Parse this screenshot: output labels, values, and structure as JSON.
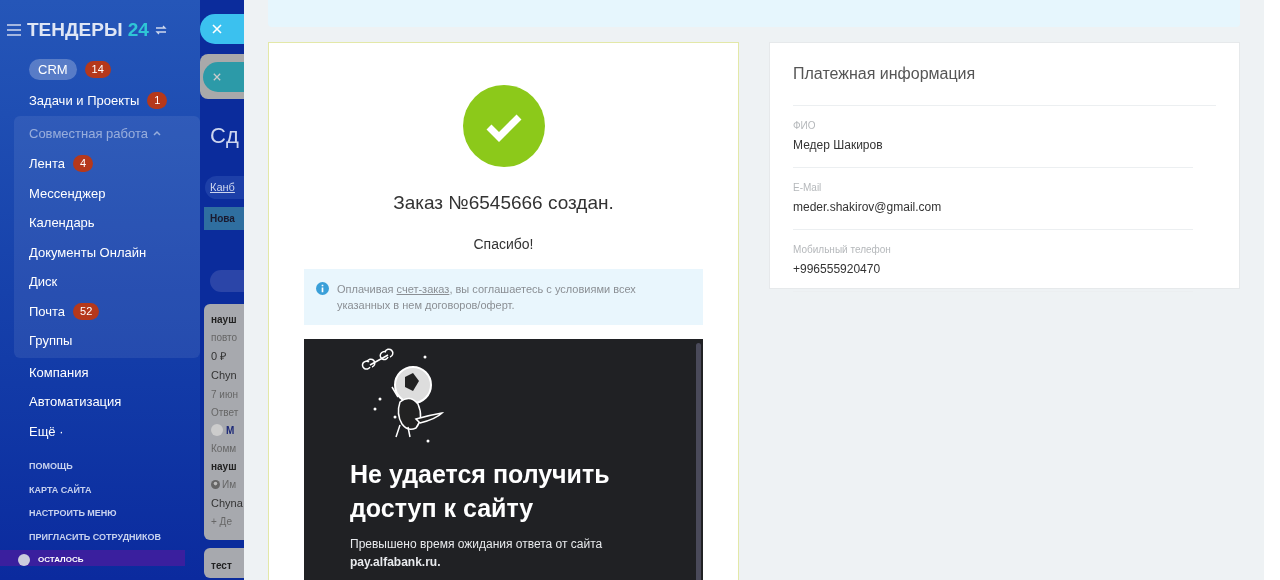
{
  "sidebar": {
    "logo": "ТЕНДЕРЫ",
    "logo_accent": "24",
    "items": [
      {
        "kind": "pill",
        "label": "CRM",
        "badge": "14"
      },
      {
        "kind": "link",
        "label": "Задачи и Проекты",
        "badge": "1"
      },
      {
        "kind": "group",
        "label": "Совместная работа",
        "expanded": true,
        "children": [
          {
            "kind": "link",
            "label": "Лента",
            "badge": "4"
          },
          {
            "kind": "link",
            "label": "Мессенджер"
          },
          {
            "kind": "link",
            "label": "Календарь"
          },
          {
            "kind": "link",
            "label": "Документы Онлайн"
          },
          {
            "kind": "link",
            "label": "Диск"
          },
          {
            "kind": "link",
            "label": "Почта",
            "badge": "52"
          },
          {
            "kind": "link",
            "label": "Группы"
          }
        ]
      },
      {
        "kind": "link",
        "label": "Компания"
      },
      {
        "kind": "link",
        "label": "Автоматизация"
      },
      {
        "kind": "link",
        "label": "Ещё ·"
      }
    ],
    "footer_links": [
      "ПОМОЩЬ",
      "КАРТА САЙТА",
      "НАСТРОИТЬ МЕНЮ",
      "ПРИГЛАСИТЬ СОТРУДНИКОВ"
    ],
    "footer_note": "ОСТАЛОСЬ"
  },
  "background_page": {
    "title": "Сд",
    "view_tab": "Канб",
    "column": "Нова",
    "card_lines": [
      {
        "kind": "title",
        "text": "науш"
      },
      {
        "kind": "muted",
        "text": "повто"
      },
      {
        "kind": "plain",
        "text": "0 ₽"
      },
      {
        "kind": "plain",
        "text": "Chyn"
      },
      {
        "kind": "muted",
        "text": "7 июн"
      },
      {
        "kind": "muted",
        "text": "Ответ"
      },
      {
        "kind": "avatar",
        "text": "M"
      },
      {
        "kind": "muted",
        "text": "Комм"
      },
      {
        "kind": "title",
        "text": "науш"
      },
      {
        "kind": "user",
        "text": "Им"
      },
      {
        "kind": "plain",
        "text": "Chyna"
      },
      {
        "kind": "muted",
        "text": "+ Де"
      }
    ],
    "next_card": "тест"
  },
  "order": {
    "title": "Заказ №6545666 создан.",
    "thanks": "Спасибо!",
    "notice_before": "Оплачивая ",
    "notice_link": "счет-заказ",
    "notice_after": ", вы соглашаетесь с условиями всех указанных в нем договоров/оферт.",
    "error_page": {
      "heading": "Не удается получить доступ к сайту",
      "message": "Превышено время ожидания ответа от сайта",
      "host": "pay.alfabank.ru."
    }
  },
  "payment_info": {
    "title": "Платежная информация",
    "fields": [
      {
        "label": "ФИО",
        "value": "Медер Шакиров"
      },
      {
        "label": "E-Mail",
        "value": "meder.shakirov@gmail.com"
      },
      {
        "label": "Мобильный телефон",
        "value": "+996555920470"
      }
    ]
  }
}
